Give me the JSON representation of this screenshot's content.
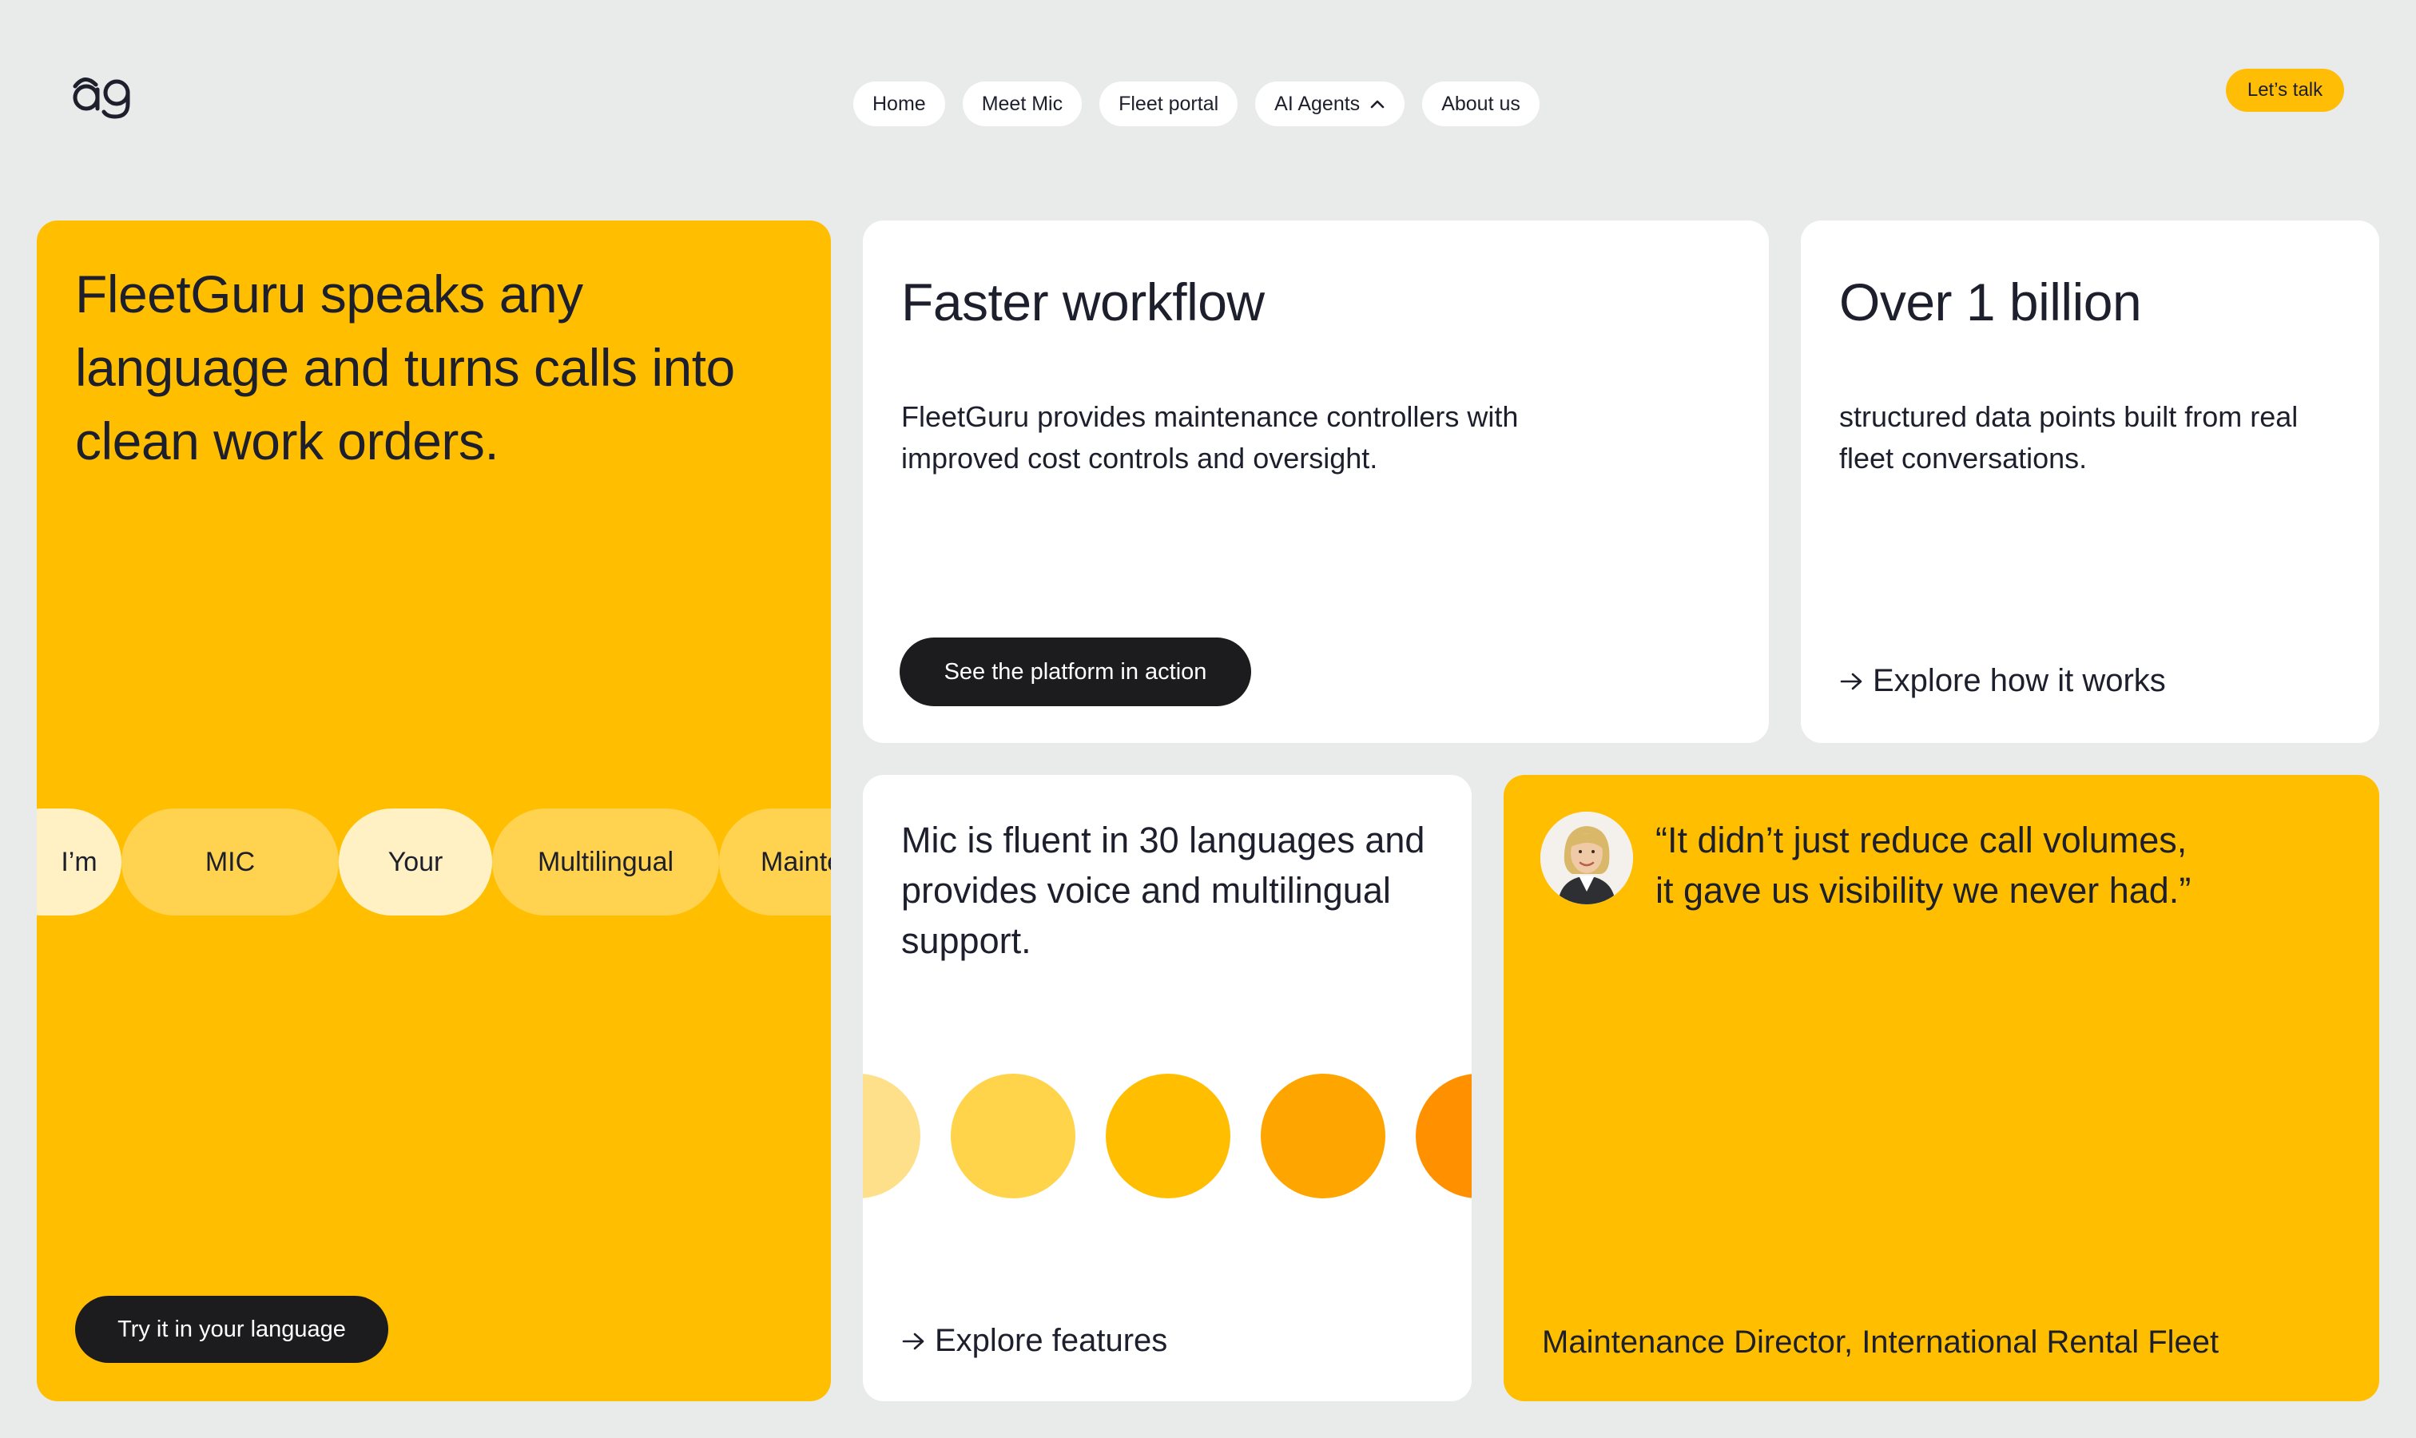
{
  "header": {
    "logo_text": "ag",
    "nav": [
      {
        "label": "Home"
      },
      {
        "label": "Meet Mic"
      },
      {
        "label": "Fleet portal"
      },
      {
        "label": "AI Agents"
      },
      {
        "label": "About us"
      }
    ],
    "cta_label": "Let’s talk"
  },
  "hero_card": {
    "headline": "FleetGuru speaks any language and turns calls into clean work orders.",
    "language_chips": [
      "I’m",
      "MIC",
      "Your",
      "Multilingual",
      "Mainte"
    ],
    "button_label": "Try it in your language"
  },
  "workflow_card": {
    "title": "Faster workflow",
    "description": "FleetGuru provides maintenance controllers with improved cost controls and oversight.",
    "button_label": "See the platform in action"
  },
  "stats_card": {
    "title": "Over 1 billion",
    "description": "structured data points built from real fleet conversations.",
    "link_label": "Explore how it works"
  },
  "languages_card": {
    "description": "Mic is fluent in 30 languages and provides voice and multilingual support.",
    "link_label": "Explore features"
  },
  "testimonial_card": {
    "quote_line1": "“It didn’t just reduce call volumes,",
    "quote_line2": "it gave us visibility we never had.”",
    "attribution": "Maintenance Director, International Rental Fleet"
  },
  "colors": {
    "background": "#e9eaea",
    "brand_yellow": "#ffbf00",
    "dark": "#1c1c1e",
    "text": "#1d1f2c"
  }
}
